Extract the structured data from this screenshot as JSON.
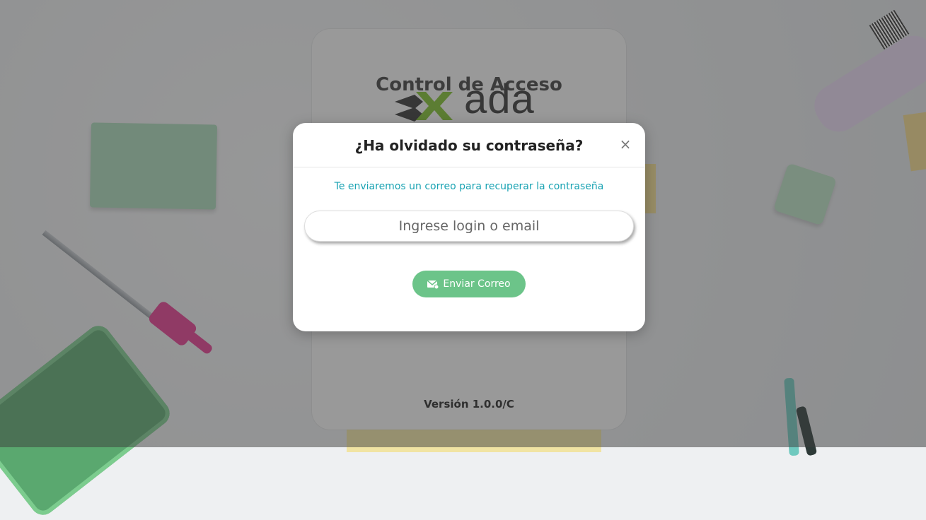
{
  "login": {
    "title": "Control de Acceso",
    "logo_text": "ada",
    "version": "Versión 1.0.0/C"
  },
  "modal": {
    "title": "¿Ha olvidado su contraseña?",
    "close": "×",
    "subtitle": "Te enviaremos un correo para recuperar la contraseña",
    "input_placeholder": "Ingrese login o email",
    "input_value": "",
    "send_label": "Enviar Correo",
    "send_icon": "mail-icon"
  },
  "colors": {
    "accent_teal": "#1aa3b3",
    "button_green": "#6cc489"
  }
}
